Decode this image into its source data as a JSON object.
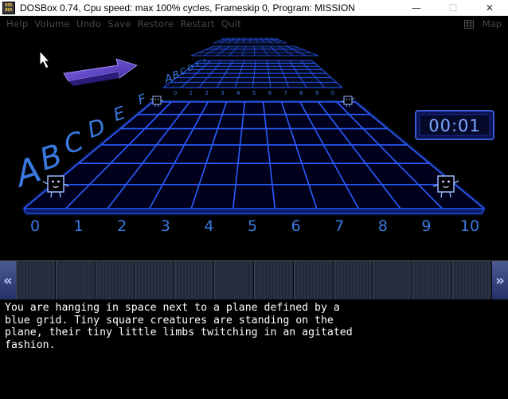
{
  "window": {
    "icon_text": [
      "DOS",
      "BOX"
    ],
    "title": "DOSBox 0.74, Cpu speed: max 100% cycles, Frameskip  0, Program:  MISSION",
    "minimize": "—",
    "maximize": "☐",
    "close": "✕"
  },
  "menu": {
    "items": [
      "Help",
      "Volume",
      "Undo",
      "Save",
      "Restore",
      "Restart",
      "Quit"
    ],
    "map": "Map"
  },
  "scene": {
    "timer": "00:01",
    "near_columns": [
      "0",
      "1",
      "2",
      "3",
      "4",
      "5",
      "6",
      "7",
      "8",
      "9",
      "10"
    ],
    "near_rows": [
      "A",
      "B",
      "C",
      "D",
      "E",
      "F"
    ],
    "mid_columns": [
      "0",
      "1",
      "2",
      "3",
      "4",
      "5",
      "6",
      "7",
      "8",
      "9",
      "0"
    ],
    "mid_rows": [
      "A",
      "B",
      "C",
      "D",
      "E",
      "F"
    ],
    "colors": {
      "grid": "#2a5cff",
      "label": "#3a7ae0",
      "timer": "#7fa8ff",
      "arrow": "#6a4adc"
    }
  },
  "inventory": {
    "left_arrow": "«",
    "right_arrow": "»",
    "slot_count": 12
  },
  "narration": "You are hanging in space next to a plane defined by a\nblue grid. Tiny square creatures are standing on the\nplane, their tiny little limbs twitching in an agitated\nfashion."
}
